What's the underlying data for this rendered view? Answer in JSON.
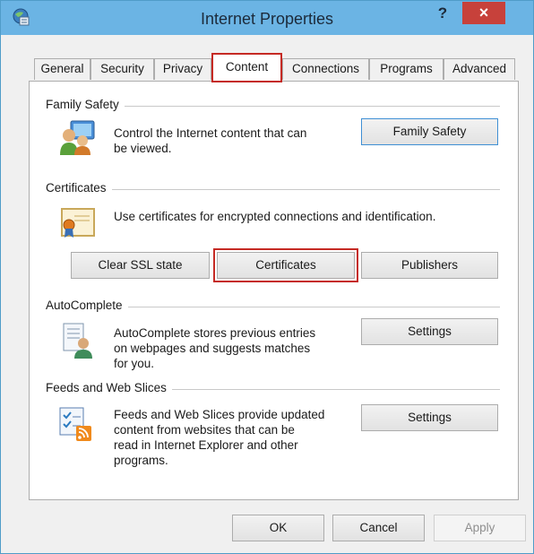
{
  "window": {
    "title": "Internet Properties",
    "help_label": "?",
    "close_label": "×"
  },
  "tabs": [
    {
      "label": "General",
      "active": false
    },
    {
      "label": "Security",
      "active": false
    },
    {
      "label": "Privacy",
      "active": false
    },
    {
      "label": "Content",
      "active": true
    },
    {
      "label": "Connections",
      "active": false
    },
    {
      "label": "Programs",
      "active": false
    },
    {
      "label": "Advanced",
      "active": false
    }
  ],
  "family_safety": {
    "heading": "Family Safety",
    "description_line1": "Control the Internet content that can",
    "description_line2": "be viewed.",
    "button_label": "Family Safety"
  },
  "certificates": {
    "heading": "Certificates",
    "description": "Use certificates for encrypted connections and identification.",
    "clear_ssl_label": "Clear SSL state",
    "certificates_label": "Certificates",
    "publishers_label": "Publishers"
  },
  "autocomplete": {
    "heading": "AutoComplete",
    "description_line1": "AutoComplete stores previous entries",
    "description_line2": "on webpages and suggests matches",
    "description_line3": "for you.",
    "settings_label": "Settings"
  },
  "feeds": {
    "heading": "Feeds and Web Slices",
    "description_line1": "Feeds and Web Slices provide updated",
    "description_line2": "content from websites that can be",
    "description_line3": "read in Internet Explorer and other",
    "description_line4": "programs.",
    "settings_label": "Settings"
  },
  "footer": {
    "ok_label": "OK",
    "cancel_label": "Cancel",
    "apply_label": "Apply"
  },
  "colors": {
    "titlebar": "#6bb4e4",
    "close": "#c7413b",
    "highlight": "#c52a24"
  }
}
